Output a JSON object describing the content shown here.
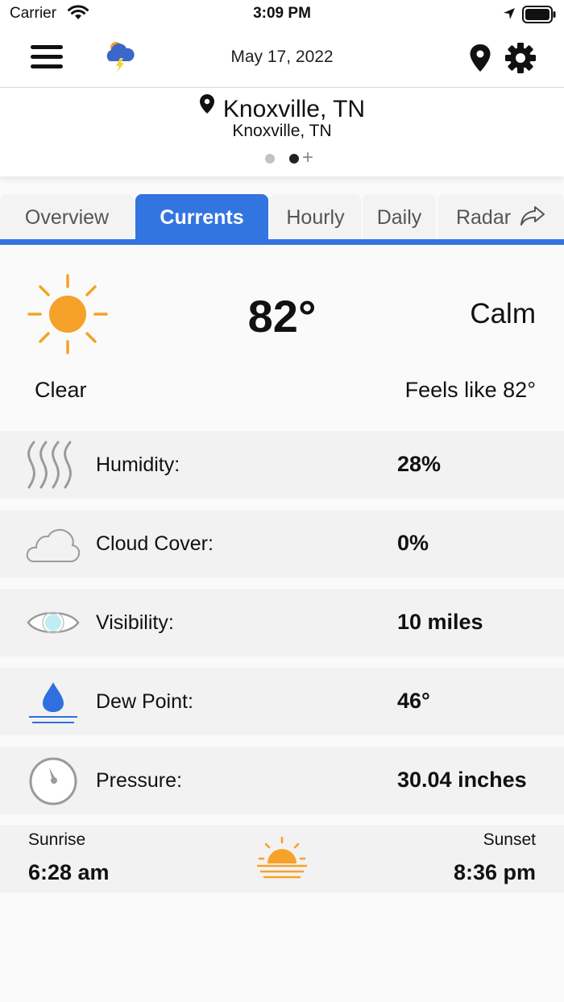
{
  "status_bar": {
    "carrier": "Carrier",
    "time": "3:09 PM"
  },
  "header": {
    "date": "May 17, 2022",
    "icons": [
      "menu-icon",
      "app-logo-icon",
      "location-pin-icon",
      "gear-icon"
    ]
  },
  "location": {
    "title": "Knoxville, TN",
    "subtitle": "Knoxville, TN",
    "page_count": 2,
    "active_page": 2
  },
  "tabs": [
    {
      "label": "Overview",
      "active": false
    },
    {
      "label": "Currents",
      "active": true
    },
    {
      "label": "Hourly",
      "active": false
    },
    {
      "label": "Daily",
      "active": false
    },
    {
      "label": "Radar",
      "active": false
    }
  ],
  "current": {
    "temperature": "82°",
    "wind": "Calm",
    "condition": "Clear",
    "feels_like": "Feels like 82°",
    "icon": "sun-icon"
  },
  "details": [
    {
      "label": "Humidity:",
      "value": "28%",
      "icon": "humidity-icon"
    },
    {
      "label": "Cloud Cover:",
      "value": "0%",
      "icon": "cloud-icon"
    },
    {
      "label": "Visibility:",
      "value": "10 miles",
      "icon": "eye-icon"
    },
    {
      "label": "Dew Point:",
      "value": "46°",
      "icon": "dew-drop-icon"
    },
    {
      "label": "Pressure:",
      "value": "30.04 inches",
      "icon": "pressure-gauge-icon"
    }
  ],
  "sun": {
    "sunrise_label": "Sunrise",
    "sunrise_time": "6:28 am",
    "sunset_label": "Sunset",
    "sunset_time": "8:36 pm"
  },
  "colors": {
    "accent": "#3375e0",
    "sun": "#f6a12a",
    "drop": "#2f6fe0"
  }
}
